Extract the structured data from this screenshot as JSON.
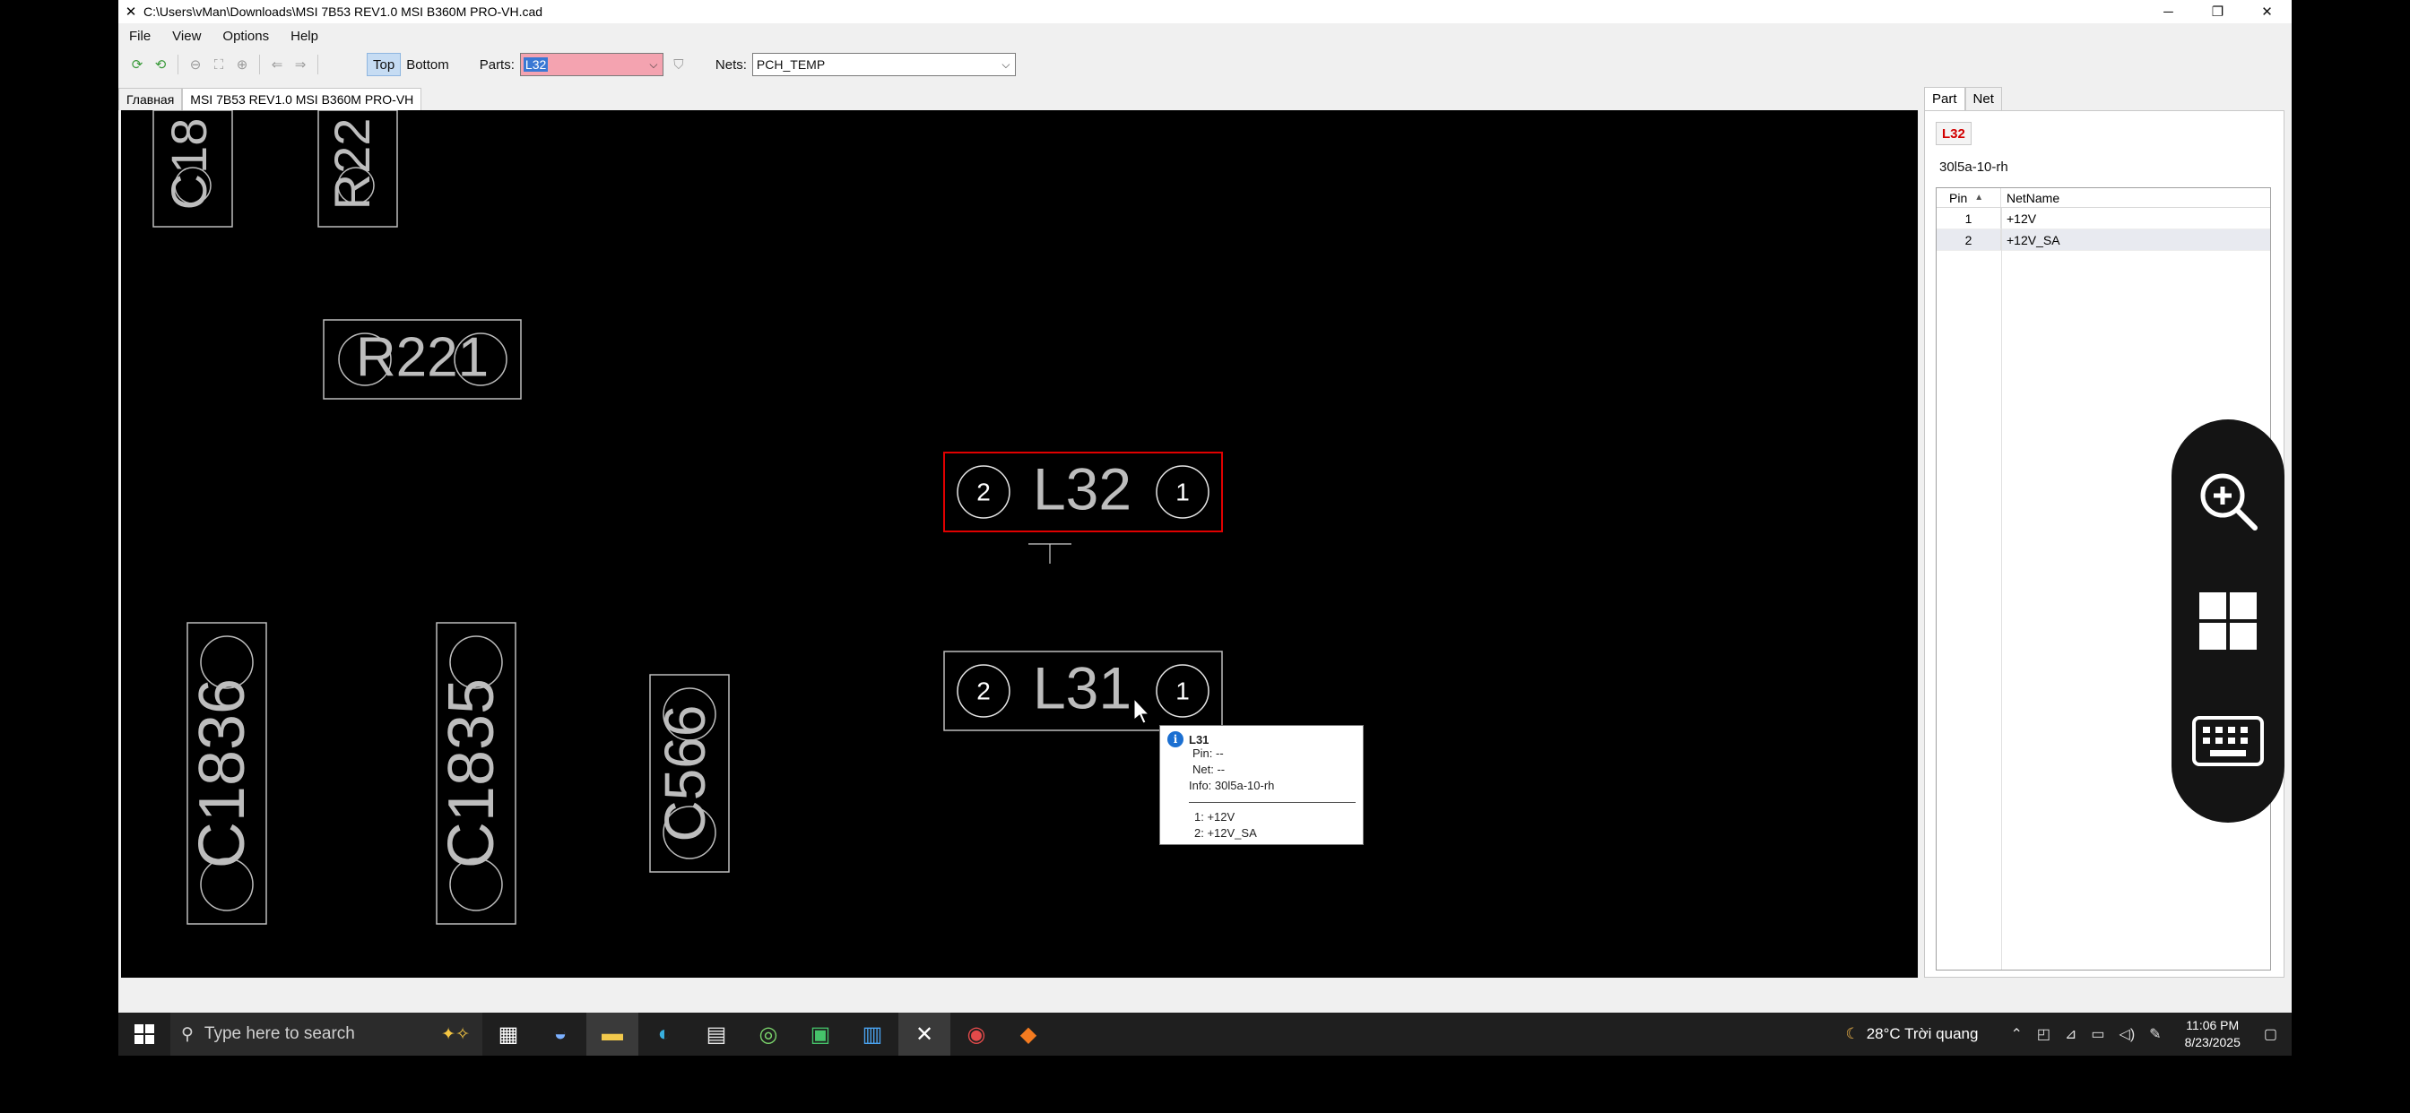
{
  "window": {
    "title": "C:\\Users\\vMan\\Downloads\\MSI 7B53 REV1.0 MSI B360M PRO-VH.cad",
    "minimize": "─",
    "restore": "❐",
    "close": "✕"
  },
  "menu": [
    "File",
    "View",
    "Options",
    "Help"
  ],
  "toolbar": {
    "top_label": "Top",
    "bottom_label": "Bottom",
    "parts_label": "Parts:",
    "parts_value": "L32",
    "nets_label": "Nets:",
    "nets_value": "PCH_TEMP"
  },
  "tabs": [
    "Главная",
    "MSI 7B53 REV1.0 MSI B360M PRO-VH"
  ],
  "board": {
    "components": [
      {
        "ref": "C18"
      },
      {
        "ref": "R22"
      },
      {
        "ref": "R221"
      },
      {
        "ref": "L32",
        "selected": true,
        "pin_left": "2",
        "pin_right": "1"
      },
      {
        "ref": "L31",
        "pin_left": "2",
        "pin_right": "1"
      },
      {
        "ref": "C1836"
      },
      {
        "ref": "C1835"
      },
      {
        "ref": "C566"
      }
    ]
  },
  "tooltip": {
    "title": "L31",
    "pin": "Pin: --",
    "net": "Net: --",
    "info": "Info: 30l5a-10-rh",
    "pin1": "1: +12V",
    "pin2": "2: +12V_SA"
  },
  "panel": {
    "tabs": [
      "Part",
      "Net"
    ],
    "part": "L32",
    "info": "30l5a-10-rh",
    "columns": [
      "Pin",
      "NetName"
    ],
    "rows": [
      {
        "pin": "1",
        "net": "+12V"
      },
      {
        "pin": "2",
        "net": "+12V_SA"
      }
    ]
  },
  "taskbar": {
    "search_placeholder": "Type here to search",
    "weather": "28°C  Trời quang",
    "time": "11:06 PM",
    "date": "8/23/2025"
  },
  "colors": {
    "selected_outline": "#e00000",
    "silkscreen": "#bdbdbd",
    "part_badge": "#d20000"
  }
}
